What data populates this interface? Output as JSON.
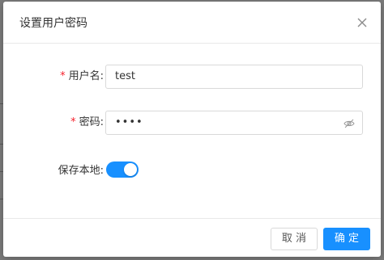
{
  "dialog": {
    "title": "设置用户密码",
    "close_icon": "close-icon"
  },
  "form": {
    "username": {
      "required_mark": "*",
      "label": "用户名:",
      "value": "test"
    },
    "password": {
      "required_mark": "*",
      "label": "密码:",
      "value_masked": "••••",
      "visibility_icon": "eye-slash-icon"
    },
    "save_local": {
      "label": "保存本地:",
      "enabled": true
    }
  },
  "footer": {
    "cancel_label": "取 消",
    "ok_label": "确 定"
  },
  "colors": {
    "primary": "#1890ff",
    "required": "#f5222d",
    "border": "#d9d9d9"
  }
}
